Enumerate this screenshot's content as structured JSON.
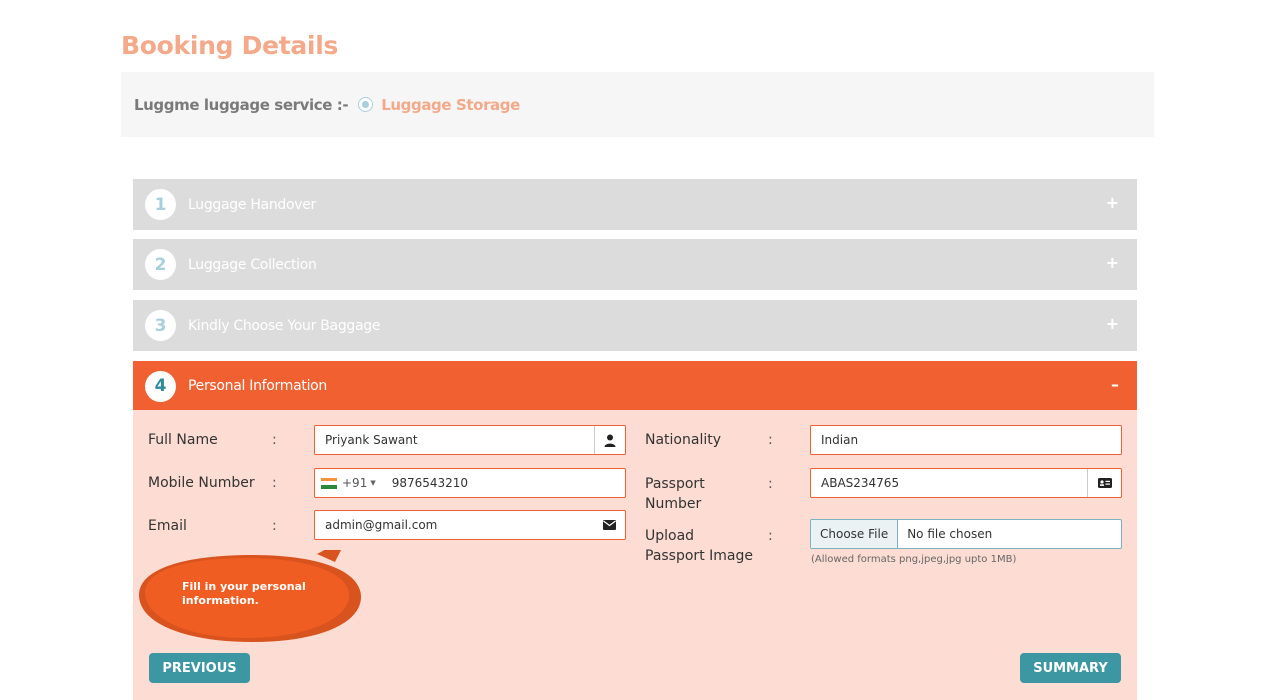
{
  "page": {
    "title": "Booking Details"
  },
  "service": {
    "label": "Luggme luggage service :-",
    "option": "Luggage Storage"
  },
  "steps": [
    {
      "number": "1",
      "title": "Luggage Handover",
      "toggle": "+"
    },
    {
      "number": "2",
      "title": "Luggage Collection",
      "toggle": "+"
    },
    {
      "number": "3",
      "title": "Kindly Choose Your Baggage",
      "toggle": "+"
    },
    {
      "number": "4",
      "title": "Personal Information",
      "toggle": "–"
    }
  ],
  "form": {
    "colon": ":",
    "full_name": {
      "label": "Full Name",
      "value": "Priyank Sawant"
    },
    "mobile": {
      "label": "Mobile Number",
      "dial_code": "+91",
      "value": "9876543210"
    },
    "email": {
      "label": "Email",
      "value": "admin@gmail.com"
    },
    "nationality": {
      "label": "Nationality",
      "value": "Indian"
    },
    "passport_number": {
      "label_line1": "Passport",
      "label_line2": "Number",
      "value": "ABAS234765"
    },
    "passport_image": {
      "label_line1": "Upload",
      "label_line2": "Passport Image",
      "button": "Choose File",
      "status": "No file chosen",
      "hint": "(Allowed formats png,jpeg,jpg upto 1MB)"
    }
  },
  "tooltip": {
    "text": "Fill in your personal information."
  },
  "buttons": {
    "previous": "PREVIOUS",
    "summary": "SUMMARY"
  },
  "colors": {
    "accent": "#f06030",
    "teal": "#3c97a3",
    "title": "#f3a98a",
    "panel_bg": "#fddcd3"
  }
}
